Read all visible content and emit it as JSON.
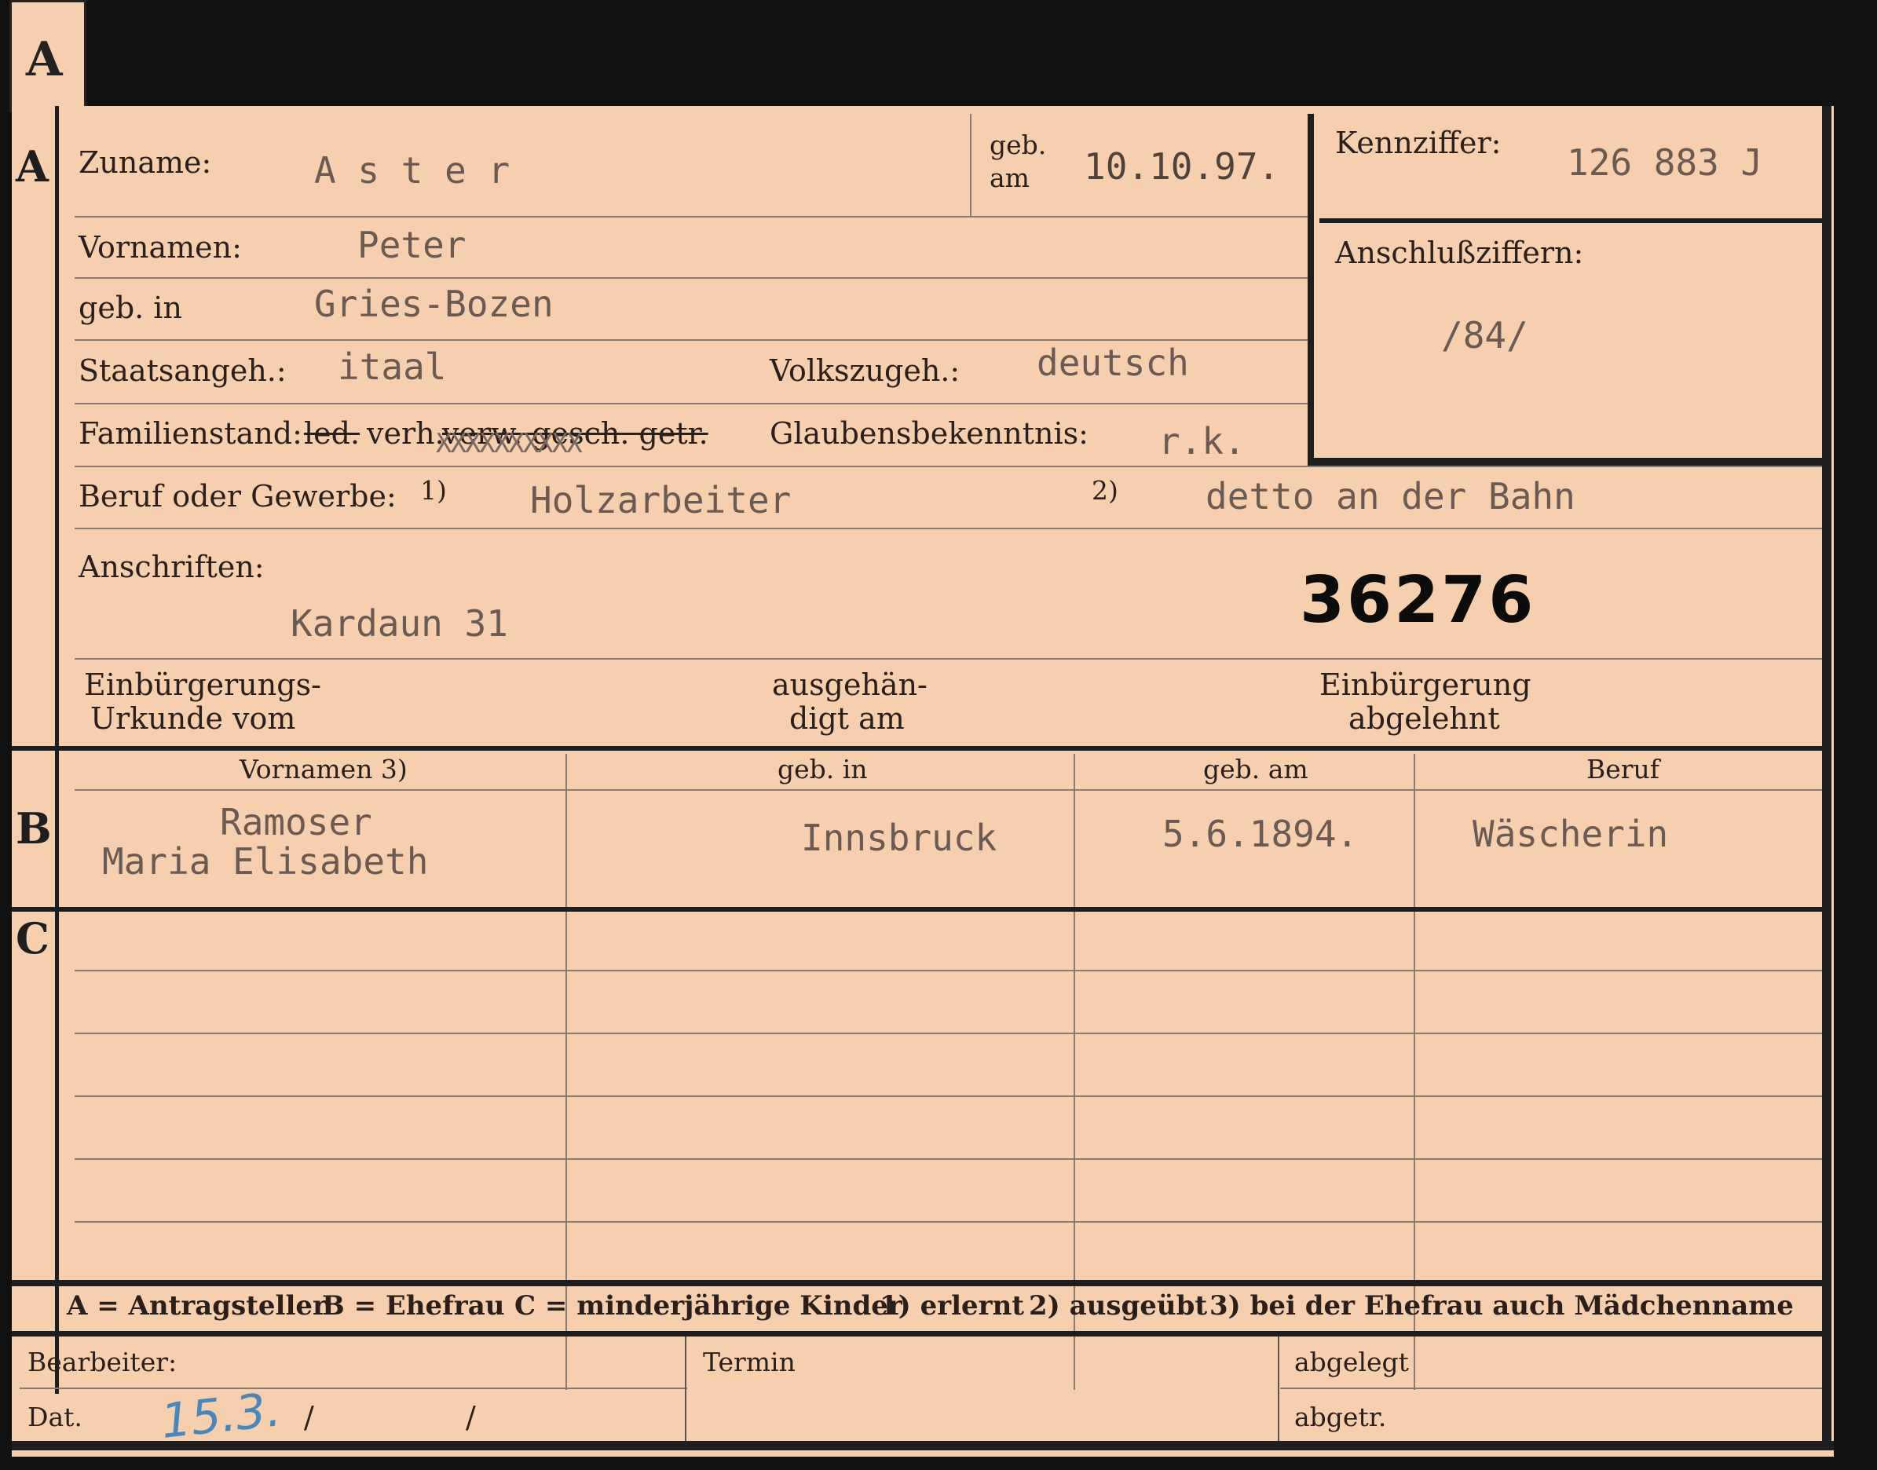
{
  "tab_letter": "A",
  "section_a": {
    "letter": "A",
    "zuname_label": "Zuname:",
    "zuname": "A s t e r",
    "geb_am_label_1": "geb.",
    "geb_am_label_2": "am",
    "geb_am": "10.10.97.",
    "kennziffer_label": "Kennziffer:",
    "kennziffer": "126 883 J",
    "vornamen_label": "Vornamen:",
    "vornamen": "Peter",
    "anschlussziffern_label": "Anschlußziffern:",
    "anschlussziffern": "/84/",
    "geb_in_label": "geb. in",
    "geb_in": "Gries-Bozen",
    "staatsangeh_label": "Staatsangeh.:",
    "staatsangeh": "itaal",
    "volkszugeh_label": "Volkszugeh.:",
    "volkszugeh": "deutsch",
    "familienstand_label": "Familienstand:",
    "familienstand_led": "led.",
    "familienstand_verh": "verh.",
    "familienstand_struck": "verw. gesch. getr.",
    "familienstand_overtype": "XXXXXXXXXX",
    "glaubens_label": "Glaubensbekenntnis:",
    "glaubens": "r.k.",
    "beruf_label": "Beruf oder Gewerbe:",
    "beruf_fn1": "1)",
    "beruf_1": "Holzarbeiter",
    "beruf_fn2": "2)",
    "beruf_2": "detto an der Bahn",
    "anschriften_label": "Anschriften:",
    "anschrift": "Kardaun 31",
    "stamp_number": "36276",
    "urkunde_label_1": "Einbürgerungs-",
    "urkunde_label_2": "Urkunde vom",
    "ausgehaendigt_label_1": "ausgehän-",
    "ausgehaendigt_label_2": "digt am",
    "abgelehnt_label_1": "Einbürgerung",
    "abgelehnt_label_2": "abgelehnt"
  },
  "section_b": {
    "letter": "B",
    "headers": [
      "Vornamen 3)",
      "geb. in",
      "geb. am",
      "Beruf"
    ],
    "surname": "Ramoser",
    "forenames": "Maria Elisabeth",
    "geb_in": "Innsbruck",
    "geb_am": "5.6.1894.",
    "beruf": "Wäscherin"
  },
  "section_c": {
    "letter": "C"
  },
  "legend": {
    "a": "A = Antragsteller",
    "b": "B = Ehefrau",
    "c": "C = minderjährige Kinder",
    "n1": "1) erlernt",
    "n2": "2) ausgeübt",
    "n3": "3) bei der Ehefrau auch Mädchenname"
  },
  "footer": {
    "bearbeiter_label": "Bearbeiter:",
    "dat_label": "Dat.",
    "dat_value": "15.3.",
    "slash_1": "/",
    "slash_2": "/",
    "termin_label": "Termin",
    "abgelegt_label": "abgelegt",
    "abgetr_label": "abgetr."
  },
  "colors": {
    "card": "#f6cfae",
    "ink": "#2a1f1a",
    "typed": "#6a5a52",
    "pencil": "#4b86b8",
    "frame": "#1e1e1e"
  }
}
